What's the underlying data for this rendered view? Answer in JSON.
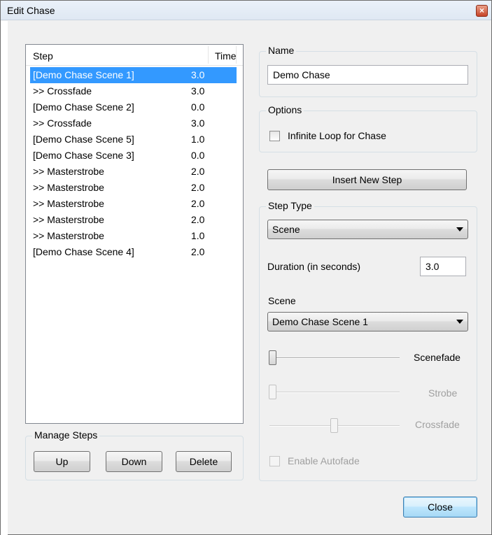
{
  "window": {
    "title": "Edit Chase"
  },
  "steps_list": {
    "columns": {
      "step": "Step",
      "time": "Time"
    },
    "rows": [
      {
        "step": "[Demo Chase Scene 1]",
        "time": "3.0",
        "selected": true
      },
      {
        "step": ">> Crossfade",
        "time": "3.0"
      },
      {
        "step": "[Demo Chase Scene 2]",
        "time": "0.0"
      },
      {
        "step": ">> Crossfade",
        "time": "3.0"
      },
      {
        "step": "[Demo Chase Scene 5]",
        "time": "1.0"
      },
      {
        "step": "[Demo Chase Scene 3]",
        "time": "0.0"
      },
      {
        "step": ">> Masterstrobe",
        "time": "2.0"
      },
      {
        "step": ">> Masterstrobe",
        "time": "2.0"
      },
      {
        "step": ">> Masterstrobe",
        "time": "2.0"
      },
      {
        "step": ">> Masterstrobe",
        "time": "2.0"
      },
      {
        "step": ">> Masterstrobe",
        "time": "1.0"
      },
      {
        "step": "[Demo Chase Scene 4]",
        "time": "2.0"
      }
    ]
  },
  "manage_steps": {
    "label": "Manage Steps",
    "up": "Up",
    "down": "Down",
    "delete": "Delete"
  },
  "name_group": {
    "label": "Name",
    "value": "Demo Chase"
  },
  "options_group": {
    "label": "Options",
    "infinite_loop": "Infinite Loop for Chase",
    "infinite_loop_checked": false
  },
  "insert_step": "Insert New Step",
  "step_type_group": {
    "label": "Step Type",
    "type_value": "Scene",
    "duration_label": "Duration (in seconds)",
    "duration_value": "3.0",
    "scene_label": "Scene",
    "scene_value": "Demo Chase Scene 1",
    "scenefade_label": "Scenefade",
    "scenefade_level": 0,
    "strobe_label": "Strobe",
    "strobe_level": 0,
    "crossfade_label": "Crossfade",
    "crossfade_level": 0.5,
    "enable_autofade": "Enable Autofade",
    "enable_autofade_checked": false
  },
  "footer": {
    "close": "Close"
  }
}
